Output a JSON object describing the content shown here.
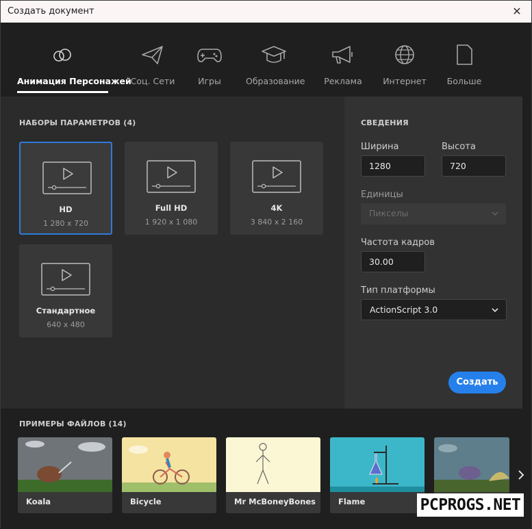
{
  "window": {
    "title": "Создать документ"
  },
  "categories": [
    {
      "label": "Анимация Персонажей",
      "icon": "character-animation-icon",
      "active": true
    },
    {
      "label": "Соц. Сети",
      "icon": "paper-plane-icon"
    },
    {
      "label": "Игры",
      "icon": "gamepad-icon"
    },
    {
      "label": "Образование",
      "icon": "graduation-cap-icon"
    },
    {
      "label": "Реклама",
      "icon": "megaphone-icon"
    },
    {
      "label": "Интернет",
      "icon": "globe-icon"
    },
    {
      "label": "Больше",
      "icon": "document-icon"
    }
  ],
  "presets": {
    "title": "НАБОРЫ ПАРАМЕТРОВ (4)",
    "items": [
      {
        "name": "HD",
        "size": "1 280 x 720",
        "selected": true
      },
      {
        "name": "Full HD",
        "size": "1 920 x 1 080"
      },
      {
        "name": "4K",
        "size": "3 840 x 2 160"
      },
      {
        "name": "Стандартное",
        "size": "640 x 480"
      }
    ]
  },
  "details": {
    "title": "СВЕДЕНИЯ",
    "width_label": "Ширина",
    "width_value": "1280",
    "height_label": "Высота",
    "height_value": "720",
    "units_label": "Единицы",
    "units_value": "Пикселы",
    "fps_label": "Частота кадров",
    "fps_value": "30.00",
    "platform_label": "Тип платформы",
    "platform_value": "ActionScript 3.0",
    "create_label": "Создать"
  },
  "samples": {
    "title": "ПРИМЕРЫ ФАЙЛОВ (14)",
    "items": [
      {
        "name": "Koala"
      },
      {
        "name": "Bicycle"
      },
      {
        "name": "Mr McBoneyBones"
      },
      {
        "name": "Flame"
      },
      {
        "name": ""
      }
    ]
  },
  "watermark": "PCPROGS.NET",
  "colors": {
    "accent": "#2680eb",
    "panel": "#2b2b2b",
    "details_panel": "#323232",
    "background": "#1f1f1f"
  }
}
